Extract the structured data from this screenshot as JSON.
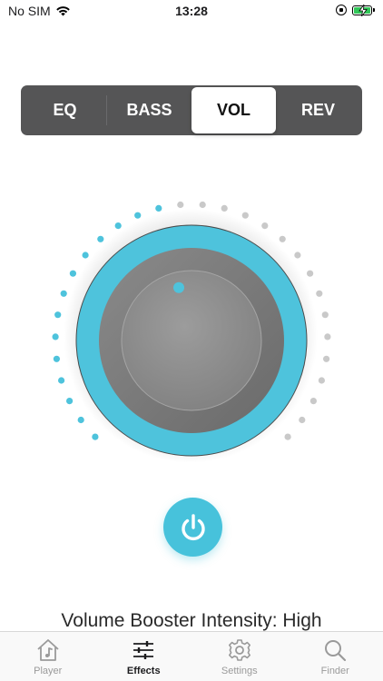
{
  "status_bar": {
    "carrier": "No SIM",
    "time": "13:28",
    "icons": [
      "wifi-icon",
      "orientation-lock-icon",
      "battery-charging-icon"
    ]
  },
  "segments": [
    {
      "label": "EQ",
      "selected": false
    },
    {
      "label": "BASS",
      "selected": false
    },
    {
      "label": "VOL",
      "selected": true
    },
    {
      "label": "REV",
      "selected": false
    }
  ],
  "knob": {
    "level": 0.45,
    "active_color": "#4ec3dc",
    "inactive_color": "#c9c9c9"
  },
  "power": {
    "icon": "power-icon",
    "color": "#47c2db"
  },
  "intensity_text": "Volume Booster Intensity: High",
  "tabs": [
    {
      "label": "Player",
      "icon": "home-music-icon",
      "active": false
    },
    {
      "label": "Effects",
      "icon": "sliders-icon",
      "active": true
    },
    {
      "label": "Settings",
      "icon": "gear-icon",
      "active": false
    },
    {
      "label": "Finder",
      "icon": "search-icon",
      "active": false
    }
  ]
}
